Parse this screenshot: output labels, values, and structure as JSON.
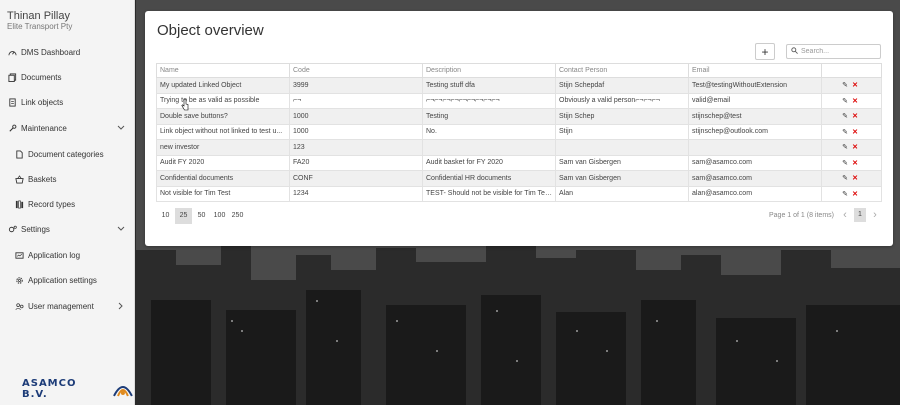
{
  "user": {
    "name": "Thinan Pillay",
    "company": "Elite Transport Pty"
  },
  "sidebar": {
    "items": [
      {
        "label": "DMS Dashboard",
        "icon": "dashboard-icon",
        "level": "top"
      },
      {
        "label": "Documents",
        "icon": "documents-icon",
        "level": "top"
      },
      {
        "label": "Link objects",
        "icon": "document-icon",
        "level": "top"
      },
      {
        "label": "Maintenance",
        "icon": "wrench-icon",
        "level": "top",
        "expandable": "down"
      },
      {
        "label": "Document categories",
        "icon": "file-icon",
        "level": "sub"
      },
      {
        "label": "Baskets",
        "icon": "basket-icon",
        "level": "sub"
      },
      {
        "label": "Record types",
        "icon": "record-types-icon",
        "level": "sub"
      },
      {
        "label": "Settings",
        "icon": "gears-icon",
        "level": "top",
        "expandable": "down"
      },
      {
        "label": "Application log",
        "icon": "log-icon",
        "level": "sub"
      },
      {
        "label": "Application settings",
        "icon": "gear-icon",
        "level": "sub"
      },
      {
        "label": "User management",
        "icon": "users-icon",
        "level": "sub",
        "expandable": "right"
      }
    ]
  },
  "logo": {
    "text": "ASAMCO B.V."
  },
  "panel": {
    "title": "Object overview",
    "add_label": "+",
    "search_placeholder": "Search..."
  },
  "table": {
    "columns": [
      "Name",
      "Code",
      "Description",
      "Contact Person",
      "Email",
      ""
    ],
    "rows": [
      [
        "My updated Linked Object",
        "3999",
        "Testing stuff dfa",
        "Stijn Schepdaf",
        "Test@testingWithoutExtension"
      ],
      [
        "Trying to be as valid as possible",
        "⌐¬",
        "⌐¬⌐¬⌐¬⌐¬⌐¬⌐¬⌐¬⌐¬⌐¬",
        "Obviously a valid person⌐¬⌐¬⌐¬",
        "valid@email"
      ],
      [
        "Double save buttons?",
        "1000",
        "Testing",
        "Stijn Schep",
        "stijnschep@test"
      ],
      [
        "Link object without not linked to test u...",
        "1000",
        "No.",
        "Stijn",
        "stijnschep@outlook.com"
      ],
      [
        "new investor",
        "123",
        "",
        "",
        ""
      ],
      [
        "Audit FY 2020",
        "FA20",
        "Audit basket for FY 2020",
        "Sam van Gisbergen",
        "sam@asamco.com"
      ],
      [
        "Confidential documents",
        "CONF",
        "Confidential HR documents",
        "Sam van Gisbergen",
        "sam@asamco.com"
      ],
      [
        "Not visible for Tim Test",
        "1234",
        "TEST- Should not be visible for Tim Tes...",
        "Alan",
        "alan@asamco.com"
      ]
    ]
  },
  "pager": {
    "sizes": [
      "10",
      "25",
      "50",
      "100",
      "250"
    ],
    "selected_index": 1,
    "info": "Page 1 of 1 (8 items)",
    "current_page": "1",
    "prev": "‹",
    "next": "›"
  },
  "colors": {
    "accent": "#1d3c78",
    "delete": "#dd0000",
    "logo_orange": "#e08a1e"
  }
}
